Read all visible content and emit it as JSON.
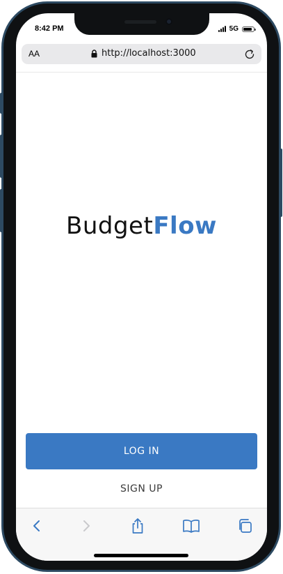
{
  "status_bar": {
    "time": "8:42 PM",
    "network": "5G",
    "battery_level": 0.85
  },
  "browser": {
    "reader_label": "AA",
    "url": "http://localhost:3000",
    "icons": {
      "lock": "lock-icon",
      "reload": "reload-icon"
    }
  },
  "app": {
    "logo_part1": "Budget",
    "logo_part2": "Flow",
    "login_label": "LOG IN",
    "signup_label": "SIGN UP"
  },
  "toolbar": {
    "items": [
      "back-icon",
      "forward-icon",
      "share-icon",
      "bookmarks-icon",
      "tabs-icon"
    ]
  },
  "colors": {
    "accent": "#3a79c3",
    "device_frame": "#2d4a62",
    "toolbar_icon": "#3a79c3",
    "toolbar_icon_disabled": "#c9c9cc"
  }
}
